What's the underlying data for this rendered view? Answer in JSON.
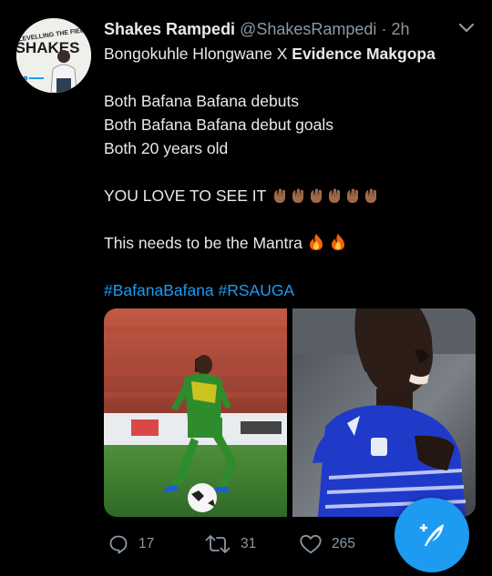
{
  "tweet": {
    "author_name": "Shakes Rampedi",
    "handle": "@ShakesRampedi",
    "separator": "·",
    "time": "2h",
    "avatar_text": "SHAKES",
    "avatar_banner_text": "LEVELLING THE FIELD",
    "lines": {
      "l1_prefix": "Bongokuhle Hlongwane X ",
      "l1_mention": "Evidence Makgopa",
      "l2": "Both Bafana Bafana debuts",
      "l3": "Both Bafana Bafana debut goals",
      "l4": "Both 20 years old",
      "l5": "YOU LOVE TO SEE IT",
      "l6": "This needs to be the Mantra",
      "hashtag1": "#BafanaBafana",
      "hashtag2": "#RSAUGA"
    },
    "emojis": {
      "clapping_hands_count": 6,
      "fire_count": 2
    },
    "media": {
      "photo1_subject": "player in green kit with ball",
      "photo2_subject": "player in blue kit celebrating"
    },
    "stats": {
      "replies": "17",
      "retweets": "31",
      "likes": "265"
    }
  },
  "icons": {
    "more": "chevron-down-icon",
    "reply": "reply-icon",
    "retweet": "retweet-icon",
    "like": "heart-icon",
    "compose": "compose-tweet-icon"
  },
  "colors": {
    "background": "#000000",
    "text": "#e7e9ea",
    "secondary": "#8b98a5",
    "accent": "#1d9bf0"
  }
}
